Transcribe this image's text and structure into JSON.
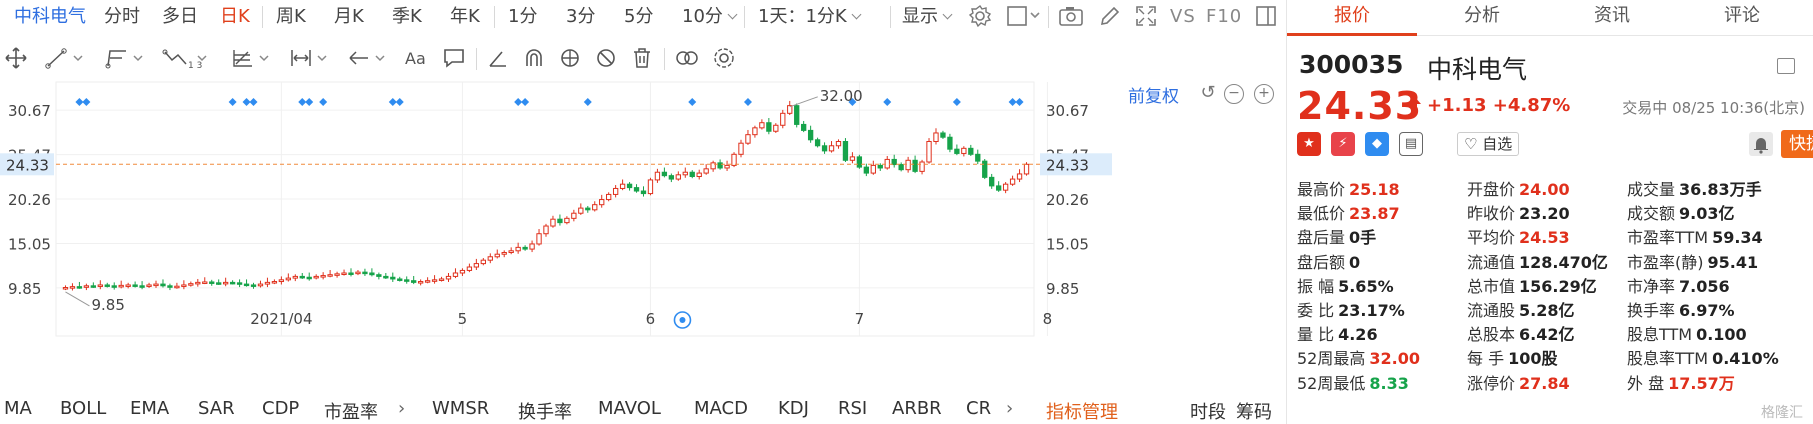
{
  "timeframes": {
    "stock_name": "中科电气",
    "items": [
      "分时",
      "多日",
      "日K",
      "周K",
      "月K",
      "季K",
      "年K",
      "1分",
      "3分",
      "5分",
      "10分"
    ],
    "active": "日K",
    "multi_period": "1天：1分K",
    "display_label": "显示",
    "vs_label": "VS",
    "f10_label": "F10"
  },
  "chart": {
    "fuquan_label": "前复权",
    "price_axis": [
      "30.67",
      "25.47",
      "20.26",
      "15.05",
      "9.85"
    ],
    "last_price_label": "24.33",
    "high_annotation": "32.00",
    "low_annotation": "9.85",
    "x_labels": [
      "2021/04",
      "5",
      "6",
      "7",
      "8"
    ],
    "colors": {
      "up": "#e0301c",
      "down": "#16a34a",
      "last_line": "#f08a3c",
      "marker": "#2f8cf0",
      "label_bg": "#dcecfb"
    }
  },
  "chart_data": {
    "type": "candlestick",
    "title": "",
    "x_ticks": [
      "2021/04",
      "5",
      "6",
      "7",
      "8"
    ],
    "ylim": [
      7.5,
      33.5
    ],
    "y_ticks": [
      30.67,
      25.47,
      20.26,
      15.05,
      9.85
    ],
    "last_price": 24.33,
    "max_label": 32.0,
    "min_label": 9.85,
    "close": [
      9.9,
      10.0,
      9.95,
      10.1,
      10.05,
      10.2,
      10.1,
      10.0,
      10.15,
      10.2,
      10.1,
      10.05,
      10.2,
      10.3,
      10.1,
      9.95,
      10.05,
      10.2,
      10.35,
      10.5,
      10.55,
      10.45,
      10.4,
      10.5,
      10.45,
      10.3,
      10.2,
      10.1,
      10.3,
      10.5,
      10.6,
      10.8,
      11.0,
      11.2,
      11.1,
      11.05,
      11.2,
      11.3,
      11.4,
      11.5,
      11.6,
      11.55,
      11.7,
      11.6,
      11.4,
      11.2,
      11.1,
      10.9,
      10.8,
      10.7,
      10.5,
      10.6,
      10.7,
      10.8,
      10.9,
      11.2,
      11.6,
      11.9,
      12.3,
      12.7,
      13.1,
      13.5,
      13.8,
      14.0,
      14.2,
      14.6,
      14.4,
      15.0,
      16.2,
      17.1,
      17.9,
      17.5,
      18.0,
      18.6,
      19.2,
      19.0,
      19.6,
      20.2,
      20.8,
      21.5,
      22.0,
      21.6,
      21.2,
      20.9,
      22.5,
      23.4,
      23.0,
      22.6,
      23.1,
      23.4,
      22.9,
      23.3,
      23.8,
      24.5,
      23.9,
      24.2,
      25.5,
      26.8,
      27.8,
      28.6,
      29.2,
      28.2,
      28.9,
      30.3,
      31.2,
      29.0,
      28.3,
      27.2,
      26.5,
      25.9,
      26.5,
      27.0,
      24.8,
      25.2,
      24.0,
      23.3,
      24.2,
      23.9,
      24.9,
      24.3,
      23.7,
      24.8,
      23.5,
      24.6,
      27.0,
      28.0,
      27.5,
      26.1,
      25.6,
      26.2,
      25.5,
      24.7,
      22.8,
      21.8,
      21.3,
      22.0,
      22.6,
      23.2,
      24.33
    ]
  },
  "indicators": {
    "items": [
      "MA",
      "BOLL",
      "EMA",
      "SAR",
      "CDP",
      "市盈率",
      "WMSR",
      "换手率",
      "MAVOL",
      "MACD",
      "KDJ",
      "RSI",
      "ARBR",
      "CR"
    ],
    "manage": "指标管理",
    "right": [
      "时段",
      "筹码"
    ]
  },
  "tabs": [
    "报价",
    "分析",
    "资讯",
    "评论"
  ],
  "quote": {
    "code": "300035",
    "name": "中科电气",
    "price": "24.33",
    "change": "+1.13",
    "change_pct": "+4.87%",
    "status": "交易中 08/25 10:36(北京)",
    "zixuan_label": "自选",
    "fast_trade": "快捷交易",
    "rows": [
      [
        [
          "最高价",
          "25.18",
          "red"
        ],
        [
          "开盘价",
          "24.00",
          "red"
        ],
        [
          "成交量",
          "36.83万手",
          "blackv"
        ]
      ],
      [
        [
          "最低价",
          "23.87",
          "red"
        ],
        [
          "昨收价",
          "23.20",
          "blackv"
        ],
        [
          "成交额",
          "9.03亿",
          "blackv"
        ]
      ],
      [
        [
          "盘后量",
          "0手",
          "blackv"
        ],
        [
          "平均价",
          "24.53",
          "red"
        ],
        [
          "市盈率TTM",
          "59.34",
          "blackv"
        ]
      ],
      [
        [
          "盘后额",
          "0",
          "blackv"
        ],
        [
          "流通值",
          "128.470亿",
          "blackv"
        ],
        [
          "市盈率(静)",
          "95.41",
          "blackv"
        ]
      ],
      [
        [
          "振 幅",
          "5.65%",
          "blackv"
        ],
        [
          "总市值",
          "156.29亿",
          "blackv"
        ],
        [
          "市净率",
          "7.056",
          "blackv"
        ]
      ],
      [
        [
          "委 比",
          "23.17%",
          "blackv"
        ],
        [
          "流通股",
          "5.28亿",
          "blackv"
        ],
        [
          "换手率",
          "6.97%",
          "blackv"
        ]
      ],
      [
        [
          "量 比",
          "4.26",
          "blackv"
        ],
        [
          "总股本",
          "6.42亿",
          "blackv"
        ],
        [
          "股息TTM",
          "0.100",
          "blackv"
        ]
      ],
      [
        [
          "52周最高",
          "32.00",
          "red"
        ],
        [
          "每 手",
          "100股",
          "blackv"
        ],
        [
          "股息率TTM",
          "0.410%",
          "blackv"
        ]
      ],
      [
        [
          "52周最低",
          "8.33",
          "green"
        ],
        [
          "涨停价",
          "27.84",
          "red"
        ],
        [
          "外 盘",
          "17.57万",
          "red"
        ]
      ]
    ],
    "watermark": "格隆汇"
  }
}
